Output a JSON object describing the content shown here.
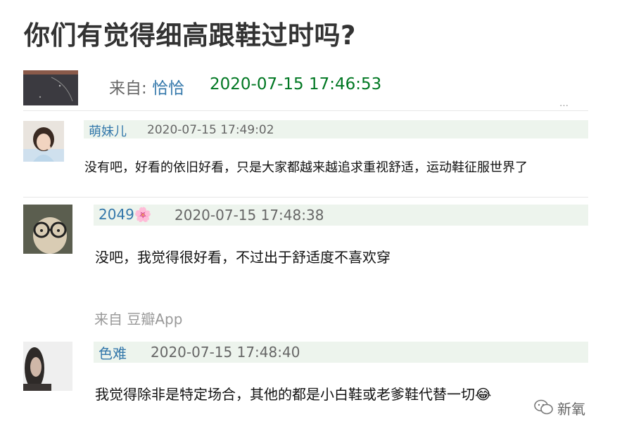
{
  "post": {
    "title": "你们有觉得细高跟鞋过时吗?",
    "from_label": "来自:",
    "author": "恰恰",
    "timestamp": "2020-07-15 17:46:53",
    "clipped_text": "…"
  },
  "comments": [
    {
      "user": "萌妹儿",
      "time": "2020-07-15 17:49:02",
      "text": "没有吧，好看的依旧好看，只是大家都越来越追求重视舒适，运动鞋征服世界了"
    },
    {
      "user": "2049",
      "user_emoji": "🌸",
      "time": "2020-07-15 17:48:38",
      "text": "没吧，我觉得很好看，不过出于舒适度不喜欢穿"
    },
    {
      "user": "色难",
      "time": "2020-07-15 17:48:40",
      "text": "我觉得除非是特定场合，其他的都是小白鞋或老爹鞋代替一切😂"
    }
  ],
  "source_label": "来自 豆瓣App",
  "watermark": "新氧",
  "colors": {
    "link": "#3377aa",
    "timestamp_green": "#007722",
    "header_bg": "#edf4ed"
  }
}
